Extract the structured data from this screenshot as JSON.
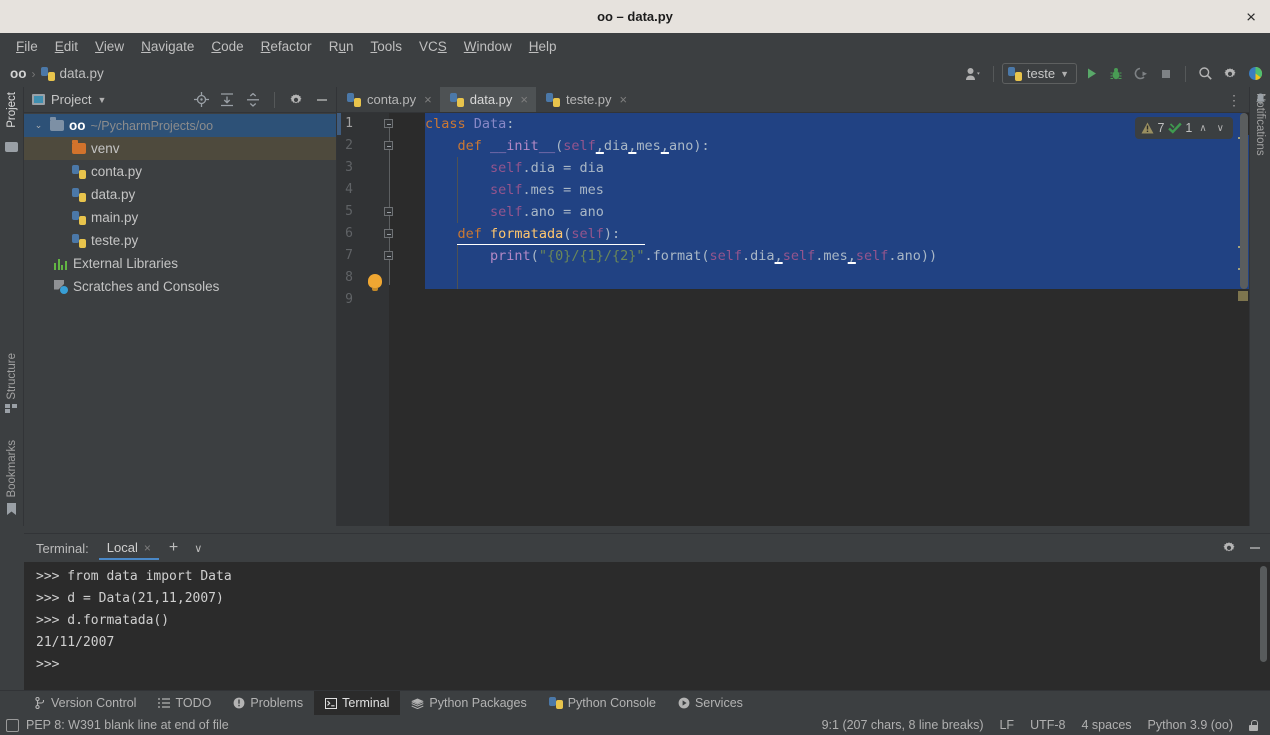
{
  "window": {
    "title": "oo – data.py",
    "close_label": "×"
  },
  "menu": {
    "items": [
      {
        "label": "File"
      },
      {
        "label": "Edit"
      },
      {
        "label": "View"
      },
      {
        "label": "Navigate"
      },
      {
        "label": "Code"
      },
      {
        "label": "Refactor"
      },
      {
        "label": "Run"
      },
      {
        "label": "Tools"
      },
      {
        "label": "VCS"
      },
      {
        "label": "Window"
      },
      {
        "label": "Help"
      }
    ]
  },
  "breadcrumb": {
    "project": "oo",
    "separator": "›",
    "file": "data.py"
  },
  "toolbar": {
    "run_config": "teste",
    "icons": [
      "user-icon",
      "run-icon",
      "debug-icon",
      "coverage-icon",
      "stop-icon",
      "search-everywhere-icon",
      "settings-icon",
      "help-icon"
    ]
  },
  "left_rail": {
    "top": "Project",
    "structure": "Structure",
    "bookmarks": "Bookmarks"
  },
  "right_rail": {
    "notifications": "Notifications"
  },
  "project_panel": {
    "title": "Project",
    "tree": [
      {
        "label": "oo",
        "path": "~/PycharmProjects/oo",
        "icon": "folder-icon",
        "indent": 0,
        "state": "selected-focused",
        "expanded": true
      },
      {
        "label": "venv",
        "path": "",
        "icon": "folder-orange-icon",
        "indent": 1,
        "state": "selected-inactive"
      },
      {
        "label": "conta.py",
        "path": "",
        "icon": "python-file-icon",
        "indent": 1,
        "state": "normal"
      },
      {
        "label": "data.py",
        "path": "",
        "icon": "python-file-icon",
        "indent": 1,
        "state": "normal"
      },
      {
        "label": "main.py",
        "path": "",
        "icon": "python-file-icon",
        "indent": 1,
        "state": "normal"
      },
      {
        "label": "teste.py",
        "path": "",
        "icon": "python-file-icon",
        "indent": 1,
        "state": "normal"
      },
      {
        "label": "External Libraries",
        "path": "",
        "icon": "library-icon",
        "indent": 0,
        "state": "normal"
      },
      {
        "label": "Scratches and Consoles",
        "path": "",
        "icon": "scratches-icon",
        "indent": 0,
        "state": "normal"
      }
    ]
  },
  "editor": {
    "tabs": [
      {
        "label": "conta.py",
        "active": false
      },
      {
        "label": "data.py",
        "active": true
      },
      {
        "label": "teste.py",
        "active": false
      }
    ],
    "line_numbers": [
      "1",
      "2",
      "3",
      "4",
      "5",
      "6",
      "7",
      "8",
      "9"
    ],
    "code_lines": [
      "class Data:",
      "    def __init__(self,dia,mes,ano):",
      "        self.dia = dia",
      "        self.mes = mes",
      "        self.ano = ano",
      "    def formatada(self):",
      "        print(\"{0}/{1}/{2}\".format(self.dia,self.mes,self.ano))",
      "",
      ""
    ],
    "inspections": {
      "warning_count": "7",
      "ok_count": "1",
      "prev_label": "∧",
      "next_label": "∨"
    }
  },
  "terminal": {
    "label": "Terminal:",
    "tab": "Local",
    "close": "×",
    "add": "+",
    "chevron": "∨",
    "lines": [
      ">>> from data import Data",
      ">>> d = Data(21,11,2007)",
      ">>> d.formatada()",
      "21/11/2007",
      ">>> "
    ]
  },
  "tool_window_bar": {
    "items": [
      {
        "label": "Version Control",
        "icon": "branch-icon",
        "active": false
      },
      {
        "label": "TODO",
        "icon": "list-icon",
        "active": false
      },
      {
        "label": "Problems",
        "icon": "error-icon",
        "active": false
      },
      {
        "label": "Terminal",
        "icon": "terminal-icon",
        "active": true
      },
      {
        "label": "Python Packages",
        "icon": "packages-icon",
        "active": false
      },
      {
        "label": "Python Console",
        "icon": "python-icon",
        "active": false
      },
      {
        "label": "Services",
        "icon": "services-icon",
        "active": false
      }
    ]
  },
  "status_bar": {
    "message": "PEP 8: W391 blank line at end of file",
    "caret": "9:1 (207 chars, 8 line breaks)",
    "line_separator": "LF",
    "encoding": "UTF-8",
    "indent": "4 spaces",
    "interpreter": "Python 3.9 (oo)"
  },
  "colors": {
    "accent_blue": "#214283",
    "keyword_orange": "#cc7832",
    "function_yellow": "#ffc66d",
    "self_purple": "#94558d",
    "string_green": "#6a8759",
    "number_blue": "#6897bb",
    "default_text": "#a9b7c6",
    "panel_bg": "#3c3f41",
    "editor_bg": "#2b2b2b"
  }
}
